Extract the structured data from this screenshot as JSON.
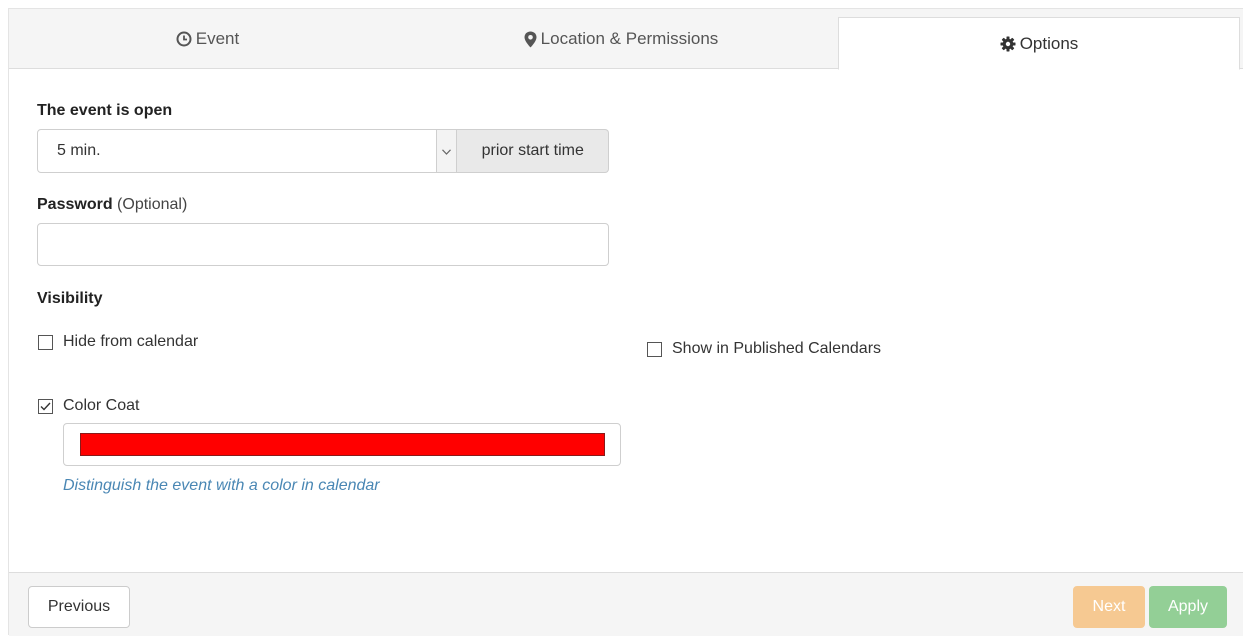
{
  "tabs": {
    "event": {
      "label": "Event",
      "icon": "clock-icon"
    },
    "location": {
      "label": "Location & Permissions",
      "icon": "map-marker-icon"
    },
    "options": {
      "label": "Options",
      "icon": "gear-icon",
      "active": true
    }
  },
  "open": {
    "label": "The event is open",
    "selected_value": "5 min.",
    "addon": "prior start time"
  },
  "password": {
    "label": "Password",
    "optional_text": "(Optional)",
    "value": ""
  },
  "visibility": {
    "label": "Visibility",
    "hide_from_calendar": {
      "label": "Hide from calendar",
      "checked": false
    },
    "show_in_published": {
      "label": "Show in Published Calendars",
      "checked": false
    },
    "color_coat": {
      "label": "Color Coat",
      "checked": true
    },
    "color_value": "#ff0000",
    "hint": "Distinguish the event with a color in calendar"
  },
  "footer": {
    "previous_label": "Previous",
    "next_label": "Next",
    "apply_label": "Apply"
  },
  "colors": {
    "next_button": "#f6c992",
    "apply_button": "#93cf96",
    "hint_text": "#4a87b4"
  }
}
